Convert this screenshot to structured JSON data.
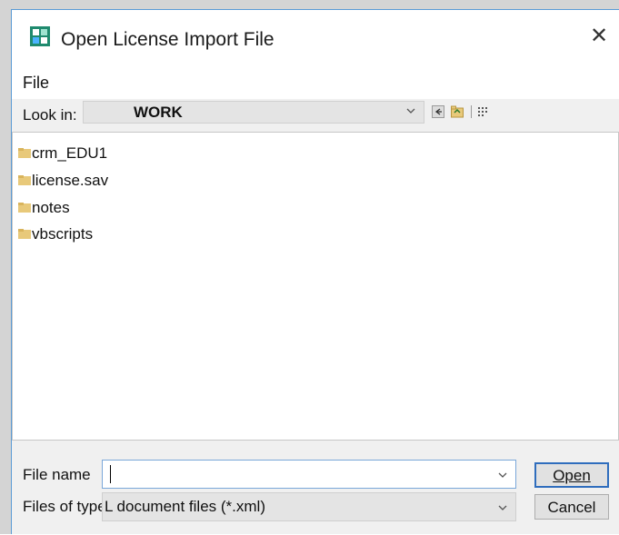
{
  "window": {
    "title": "Open License Import File",
    "close_glyph": "✕",
    "app_icon": "license-app-icon"
  },
  "menu": {
    "file_label": "File"
  },
  "look_in": {
    "label": "Look in:",
    "value": "WORK",
    "toolbar_icons": [
      "back-arrow-icon",
      "up-folder-icon",
      "view-list-icon"
    ]
  },
  "files": [
    {
      "name": "crm_EDU1",
      "icon": "folder-icon"
    },
    {
      "name": "license.sav",
      "icon": "folder-icon"
    },
    {
      "name": "notes",
      "icon": "folder-icon"
    },
    {
      "name": "vbscripts",
      "icon": "folder-icon"
    }
  ],
  "file_name": {
    "label": "File name",
    "value": ""
  },
  "file_type": {
    "label": "Files of type:",
    "value": "L document files (*.xml)"
  },
  "buttons": {
    "open": "Open",
    "cancel": "Cancel"
  },
  "colors": {
    "accent": "#2f6dbd",
    "folder": "#e8c97a",
    "border": "#5b9bd5"
  }
}
